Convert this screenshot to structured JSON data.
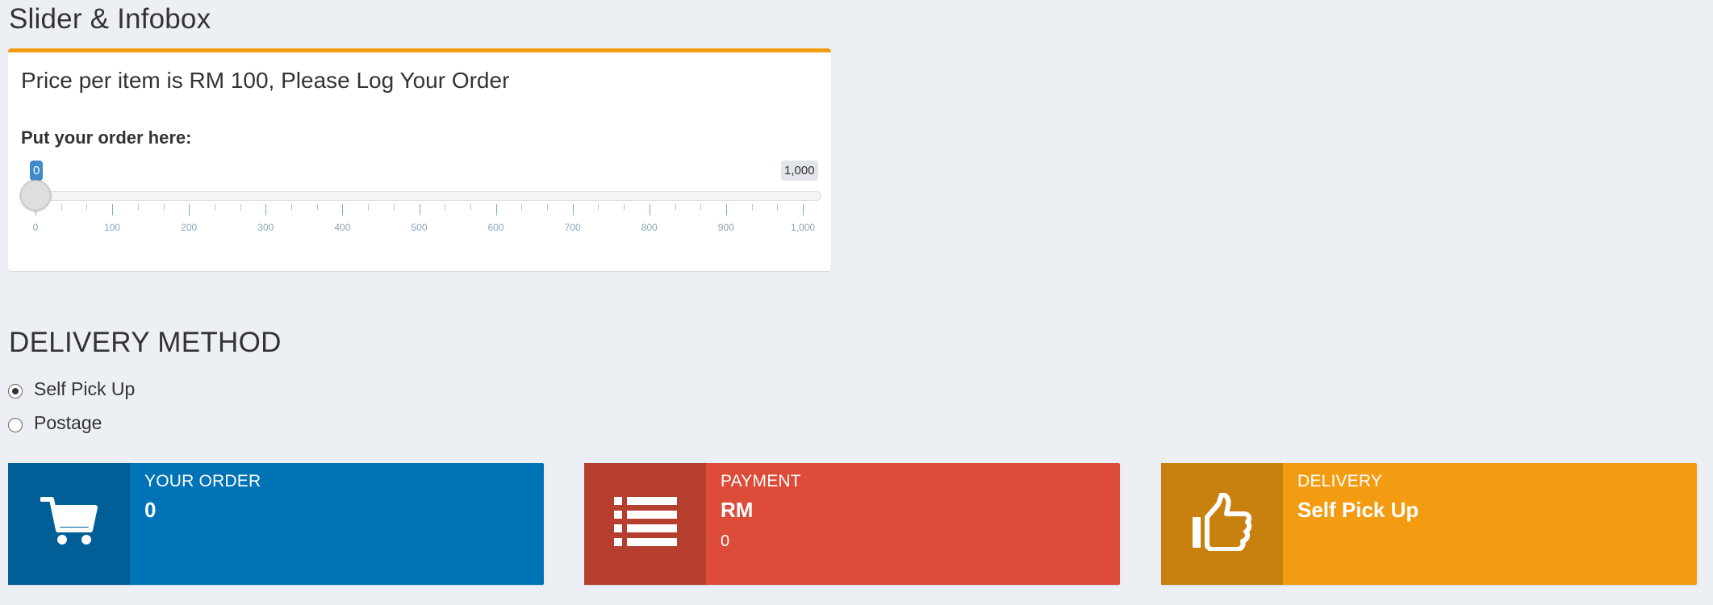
{
  "page": {
    "title": "Slider & Infobox"
  },
  "order_box": {
    "title": "Price per item is RM 100, Please Log Your Order",
    "slider": {
      "label": "Put your order here:",
      "min": 0,
      "max": 1000,
      "value": 0,
      "min_tag": "0",
      "max_tag": "1,000",
      "tick_labels": [
        "0",
        "100",
        "200",
        "300",
        "400",
        "500",
        "600",
        "700",
        "800",
        "900",
        "1,000"
      ],
      "accent_color": "#428bca"
    },
    "border_color": "#f39c12"
  },
  "delivery": {
    "heading": "DELIVERY METHOD",
    "options": [
      {
        "label": "Self Pick Up",
        "checked": true
      },
      {
        "label": "Postage",
        "checked": false
      }
    ]
  },
  "infoboxes": [
    {
      "title": "YOUR ORDER",
      "value": "0",
      "sub": "",
      "icon": "shopping-cart-icon",
      "color": "#0073b7"
    },
    {
      "title": "PAYMENT",
      "value": "RM",
      "sub": "0",
      "icon": "list-icon",
      "color": "#dd4b39"
    },
    {
      "title": "DELIVERY",
      "value": "Self Pick Up",
      "sub": "",
      "icon": "thumbs-up-icon",
      "color": "#f39c12"
    }
  ]
}
